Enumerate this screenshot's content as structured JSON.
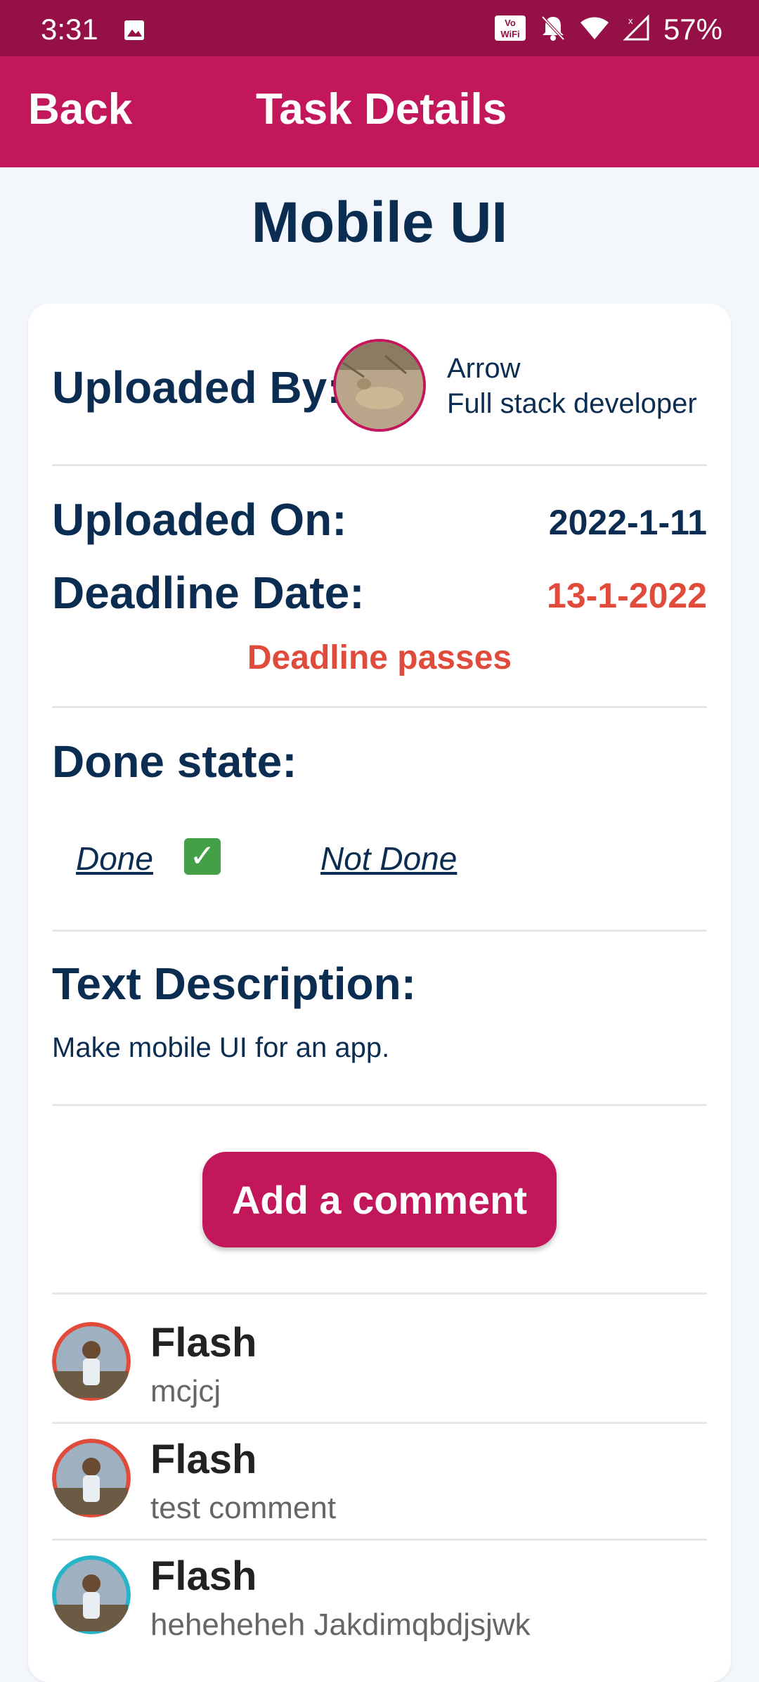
{
  "status_bar": {
    "time": "3:31",
    "battery": "57%",
    "wifi_badge": "Vo WiFi"
  },
  "app_bar": {
    "back_label": "Back",
    "title": "Task Details"
  },
  "task": {
    "title": "Mobile UI",
    "uploaded_by_label": "Uploaded By:",
    "uploader_name": "Arrow",
    "uploader_role": "Full stack developer",
    "uploaded_on_label": "Uploaded On:",
    "uploaded_on": "2022-1-11",
    "deadline_label": "Deadline Date:",
    "deadline": "13-1-2022",
    "deadline_message": "Deadline passes",
    "done_state_label": "Done state:",
    "done_option": "Done",
    "not_done_option": "Not Done",
    "done_checked": true,
    "description_label": "Text Description:",
    "description": "Make mobile UI for an app.",
    "add_comment_label": "Add a comment"
  },
  "comments": [
    {
      "name": "Flash",
      "text": "mcjcj",
      "ring_color": "#e04b3c"
    },
    {
      "name": "Flash",
      "text": "test comment",
      "ring_color": "#e04b3c"
    },
    {
      "name": "Flash",
      "text": "heheheheh Jakdimqbdjsjwk",
      "ring_color": "#26b5c8"
    }
  ],
  "colors": {
    "primary": "#c2185b",
    "status_bar": "#941046",
    "heading": "#0c2d52",
    "deadline_red": "#e04b3c",
    "check_green": "#43a047"
  }
}
